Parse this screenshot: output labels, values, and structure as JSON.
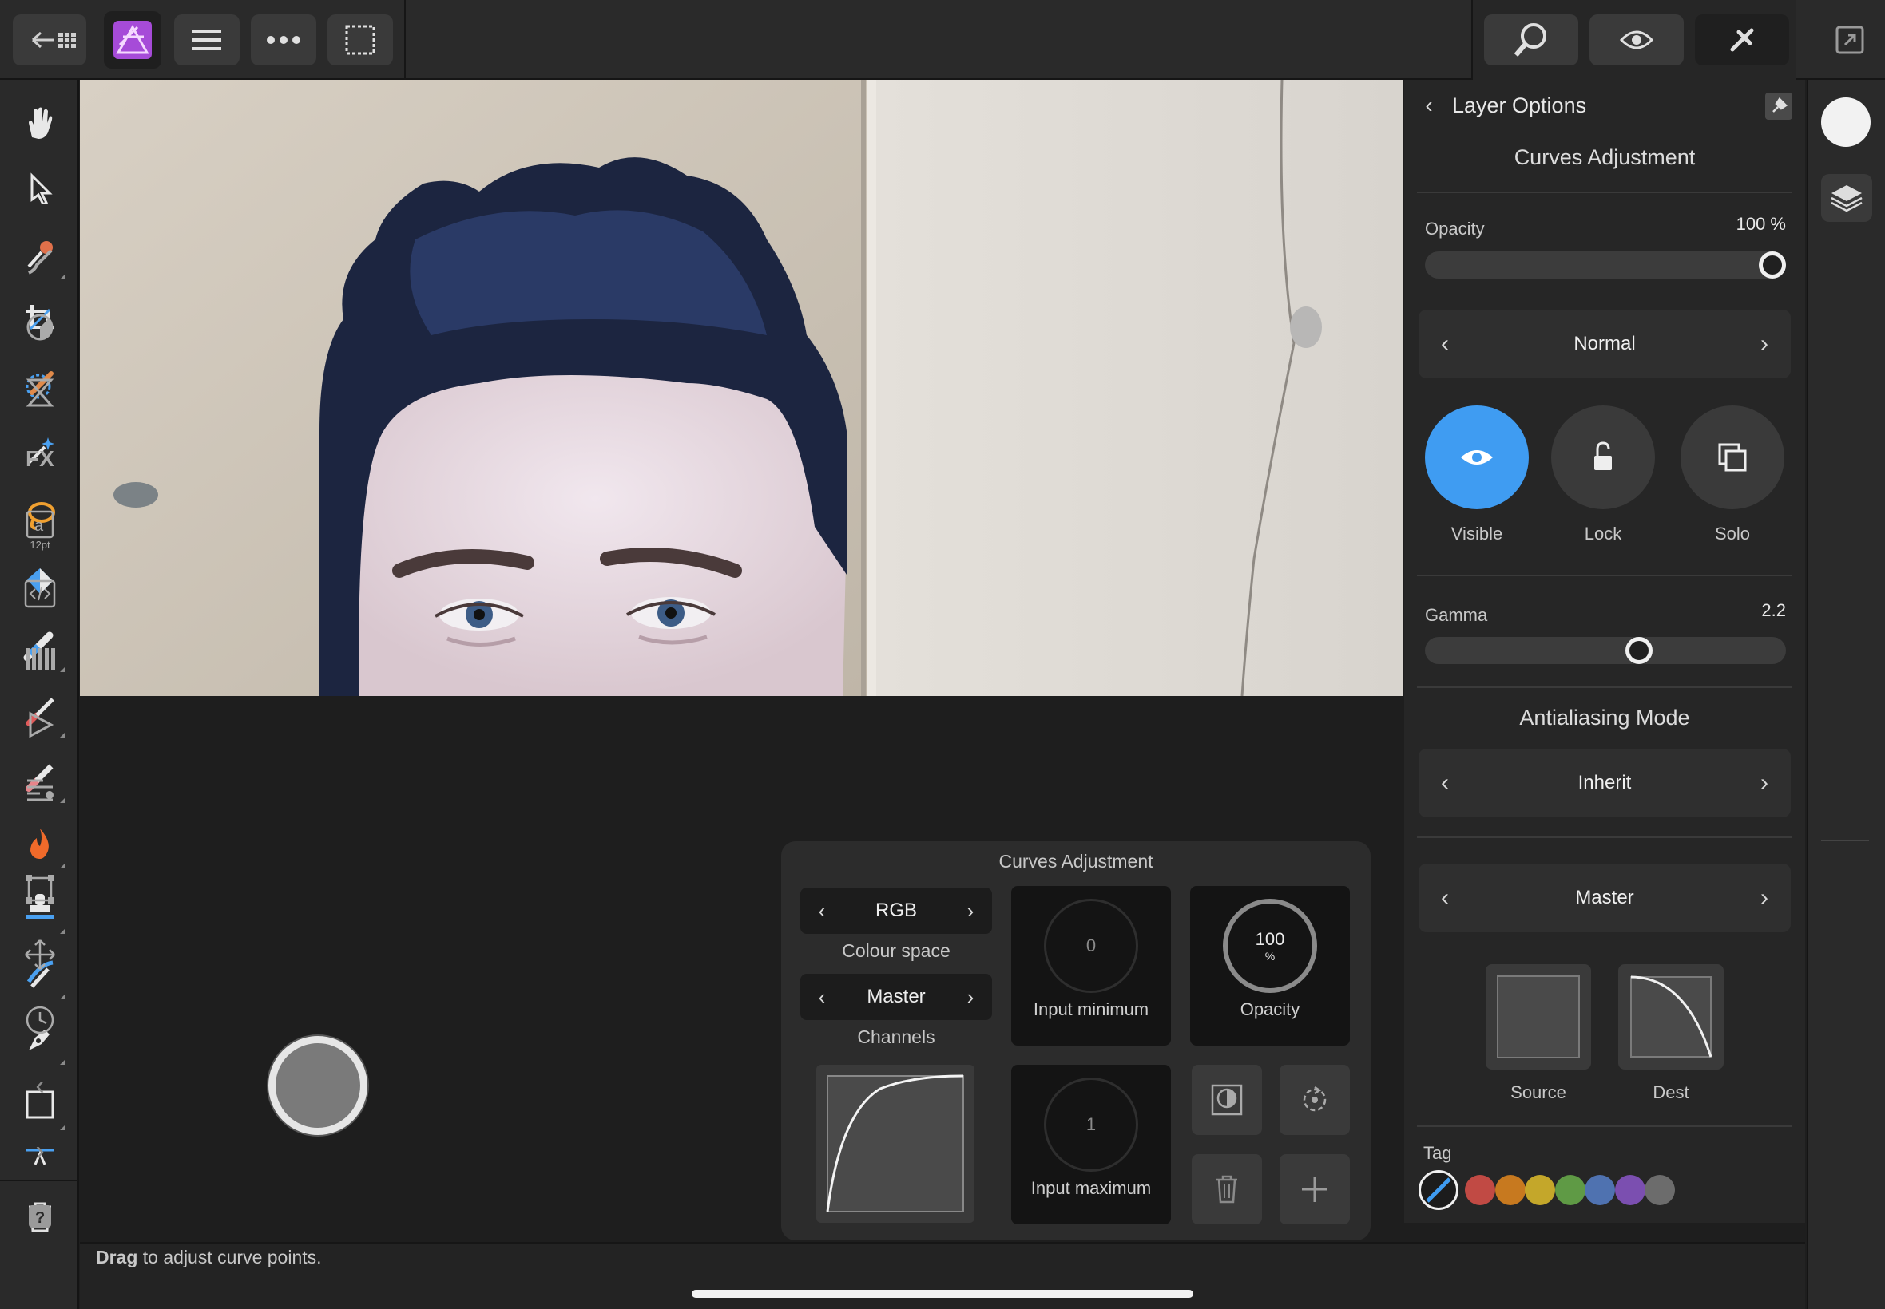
{
  "panel": {
    "back_title": "Layer Options",
    "section_title": "Curves Adjustment",
    "opacity_label": "Opacity",
    "opacity_value": "100 %",
    "opacity_fraction": 1.0,
    "blend_mode": "Normal",
    "visible_label": "Visible",
    "lock_label": "Lock",
    "solo_label": "Solo",
    "gamma_label": "Gamma",
    "gamma_value": "2.2",
    "gamma_fraction": 0.6,
    "antialias_title": "Antialiasing Mode",
    "antialias_value": "Inherit",
    "channel_value": "Master",
    "source_label": "Source",
    "dest_label": "Dest",
    "tag_label": "Tag",
    "tag_colors": [
      "#c14a44",
      "#c7791f",
      "#c4a72a",
      "#5f9a45",
      "#4f72b0",
      "#7b4fb0",
      "#6c6c6c"
    ]
  },
  "popover": {
    "title": "Curves Adjustment",
    "colour_space_value": "RGB",
    "colour_space_label": "Colour space",
    "channel_value": "Master",
    "channels_label": "Channels",
    "input_min_value": "0",
    "input_min_label": "Input minimum",
    "opacity_value": "100",
    "opacity_unit": "%",
    "opacity_label": "Opacity",
    "input_max_value": "1",
    "input_max_label": "Input maximum"
  },
  "status": {
    "bold": "Drag",
    "text": " to adjust curve points."
  },
  "right_strip": {
    "text_size_label": "12pt"
  },
  "colors": {
    "accent_blue": "#3f9cf2",
    "panel_bg": "#262626"
  }
}
